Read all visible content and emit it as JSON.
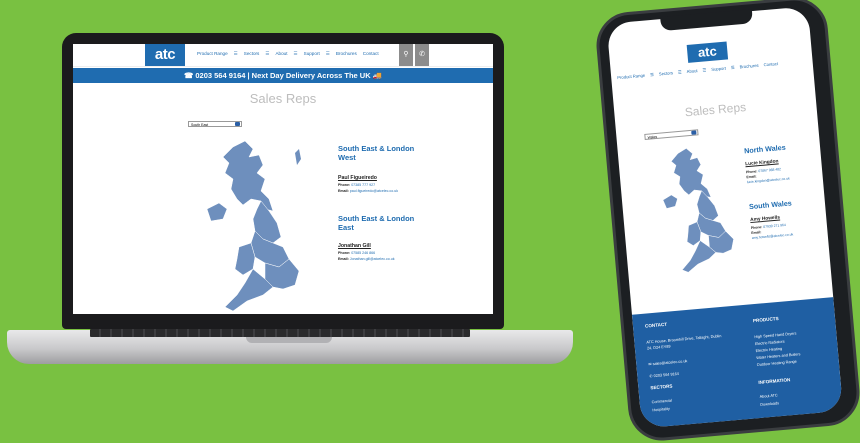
{
  "laptop": {
    "logo": "atc",
    "nav": [
      "Product Range",
      "☰",
      "Sectors",
      "☰",
      "About",
      "☰",
      "Support",
      "☰",
      "Brochures",
      "Contact"
    ],
    "search_icon": "search-icon",
    "phone_icon": "phone-icon",
    "contact_bar": "☎ 0203 564 9164  |  Next Day Delivery Across The UK 🚚",
    "page_title": "Sales Reps",
    "region_select": "South East",
    "reps": [
      {
        "region": "South East & London West",
        "name": "Paul Figueiredo",
        "phone_label": "Phone:",
        "phone": "07385 777 927",
        "email_label": "Email:",
        "email": "paul.figueiredo@atcelec.co.uk"
      },
      {
        "region": "South East & London East",
        "name": "Jonathan Gill",
        "phone_label": "Phone:",
        "phone": "07585 246 866",
        "email_label": "Email:",
        "email": "Jonathan.gill@atcelec.co.uk"
      }
    ]
  },
  "phone": {
    "logo": "atc",
    "nav": [
      "Product Range",
      "☰",
      "Sectors",
      "☰",
      "About",
      "☰",
      "Support",
      "☰",
      "Brochures",
      "Contact"
    ],
    "page_title": "Sales Reps",
    "region_select": "Wales",
    "reps": [
      {
        "region": "North Wales",
        "name": "Lucie Kingdon",
        "phone_label": "Phone:",
        "phone": "07867 988 482",
        "email_label": "Email:",
        "email": "lucie.kingdon@atcelec.co.uk"
      },
      {
        "region": "South Wales",
        "name": "Amy Howells",
        "phone_label": "Phone:",
        "phone": "07930 271 964",
        "email_label": "Email:",
        "email": "amy.howells@atcelec.co.uk"
      }
    ],
    "footer": {
      "contact_heading": "CONTACT",
      "address": "ATC House, Broomhill Drive, Tallaght, Dublin 24, D24 EY89",
      "email": "sales@atcelec.co.uk",
      "phone": "0203 564 9164",
      "sectors_heading": "SECTORS",
      "sectors": [
        "Commercial",
        "Hospitality"
      ],
      "products_heading": "PRODUCTS",
      "products": [
        "High Speed Hand Dryers",
        "Electric Radiators",
        "Electric Heating",
        "Water Heaters and Boilers",
        "Outdoor Heating Range"
      ],
      "information_heading": "INFORMATION",
      "information": [
        "About ATC",
        "Downloads"
      ]
    }
  },
  "colors": {
    "background": "#79c141",
    "brand_blue": "#1f6cb0",
    "map_blue": "#6e8fbd",
    "title_grey": "#bdbdbd"
  }
}
